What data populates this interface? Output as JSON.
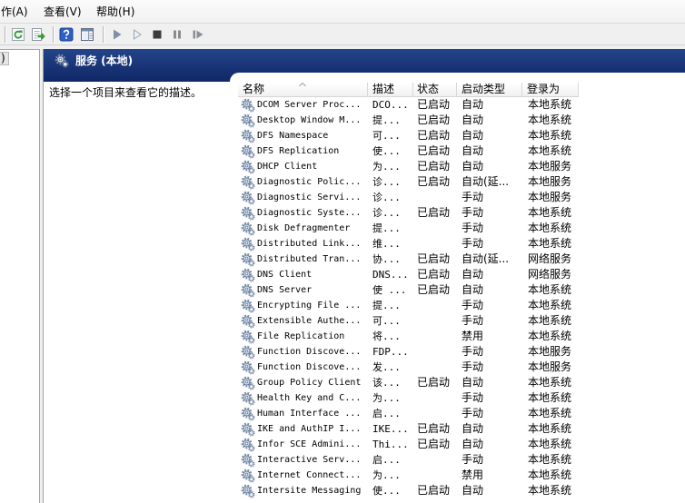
{
  "menu": {
    "items": [
      {
        "label": "作(A)"
      },
      {
        "label": "查看(V)"
      },
      {
        "label": "帮助(H)"
      }
    ]
  },
  "toolbar": {
    "buttons": [
      {
        "icon": "refresh-icon"
      },
      {
        "icon": "export-list-icon"
      },
      {
        "icon": "help-icon"
      },
      {
        "icon": "show-hide-pane-icon"
      },
      {
        "icon": "start-service-icon"
      },
      {
        "icon": "start-service-outline-icon"
      },
      {
        "icon": "stop-service-icon"
      },
      {
        "icon": "pause-service-icon"
      },
      {
        "icon": "restart-service-icon"
      }
    ]
  },
  "tree": {
    "selected_item_label": ")"
  },
  "panel": {
    "title": "服务 (本地)",
    "title_icon": "services-gear-icon",
    "description_hint": "选择一个项目来查看它的描述。"
  },
  "list": {
    "columns": [
      "名称",
      "描述",
      "状态",
      "启动类型",
      "登录为"
    ],
    "sort_icon": "sort-ascending-icon",
    "row_icon": "service-gear-icon",
    "rows": [
      {
        "name": "DCOM Server Proc...",
        "description": "DCO...",
        "status": "已启动",
        "startup_type": "自动",
        "log_on_as": "本地系统"
      },
      {
        "name": "Desktop Window M...",
        "description": "提...",
        "status": "已启动",
        "startup_type": "自动",
        "log_on_as": "本地系统"
      },
      {
        "name": "DFS Namespace",
        "description": "可...",
        "status": "已启动",
        "startup_type": "自动",
        "log_on_as": "本地系统"
      },
      {
        "name": "DFS Replication",
        "description": "使...",
        "status": "已启动",
        "startup_type": "自动",
        "log_on_as": "本地系统"
      },
      {
        "name": "DHCP Client",
        "description": "为...",
        "status": "已启动",
        "startup_type": "自动",
        "log_on_as": "本地服务"
      },
      {
        "name": "Diagnostic Polic...",
        "description": "诊...",
        "status": "已启动",
        "startup_type": "自动(延...",
        "log_on_as": "本地服务"
      },
      {
        "name": "Diagnostic Servi...",
        "description": "诊...",
        "status": "",
        "startup_type": "手动",
        "log_on_as": "本地服务"
      },
      {
        "name": "Diagnostic Syste...",
        "description": "诊...",
        "status": "已启动",
        "startup_type": "手动",
        "log_on_as": "本地系统"
      },
      {
        "name": "Disk Defragmenter",
        "description": "提...",
        "status": "",
        "startup_type": "手动",
        "log_on_as": "本地系统"
      },
      {
        "name": "Distributed Link...",
        "description": "维...",
        "status": "",
        "startup_type": "手动",
        "log_on_as": "本地系统"
      },
      {
        "name": "Distributed Tran...",
        "description": "协...",
        "status": "已启动",
        "startup_type": "自动(延...",
        "log_on_as": "网络服务"
      },
      {
        "name": "DNS Client",
        "description": "DNS...",
        "status": "已启动",
        "startup_type": "自动",
        "log_on_as": "网络服务"
      },
      {
        "name": "DNS Server",
        "description": "使 ...",
        "status": "已启动",
        "startup_type": "自动",
        "log_on_as": "本地系统"
      },
      {
        "name": "Encrypting File ...",
        "description": "提...",
        "status": "",
        "startup_type": "手动",
        "log_on_as": "本地系统"
      },
      {
        "name": "Extensible Authe...",
        "description": "可...",
        "status": "",
        "startup_type": "手动",
        "log_on_as": "本地系统"
      },
      {
        "name": "File Replication",
        "description": "将...",
        "status": "",
        "startup_type": "禁用",
        "log_on_as": "本地系统"
      },
      {
        "name": "Function Discove...",
        "description": "FDP...",
        "status": "",
        "startup_type": "手动",
        "log_on_as": "本地服务"
      },
      {
        "name": "Function Discove...",
        "description": "发...",
        "status": "",
        "startup_type": "手动",
        "log_on_as": "本地服务"
      },
      {
        "name": "Group Policy Client",
        "description": "该...",
        "status": "已启动",
        "startup_type": "自动",
        "log_on_as": "本地系统"
      },
      {
        "name": "Health Key and C...",
        "description": "为...",
        "status": "",
        "startup_type": "手动",
        "log_on_as": "本地系统"
      },
      {
        "name": "Human Interface ...",
        "description": "启...",
        "status": "",
        "startup_type": "手动",
        "log_on_as": "本地系统"
      },
      {
        "name": "IKE and AuthIP I...",
        "description": "IKE...",
        "status": "已启动",
        "startup_type": "自动",
        "log_on_as": "本地系统"
      },
      {
        "name": "Infor SCE Admini...",
        "description": "Thi...",
        "status": "已启动",
        "startup_type": "自动",
        "log_on_as": "本地系统"
      },
      {
        "name": "Interactive Serv...",
        "description": "启...",
        "status": "",
        "startup_type": "手动",
        "log_on_as": "本地系统"
      },
      {
        "name": "Internet Connect...",
        "description": "为...",
        "status": "",
        "startup_type": "禁用",
        "log_on_as": "本地系统"
      },
      {
        "name": "Intersite Messaging",
        "description": "使...",
        "status": "已启动",
        "startup_type": "自动",
        "log_on_as": "本地系统"
      }
    ]
  },
  "colors": {
    "window_bg": "#f0f0f0",
    "header_band_top": "#24448a",
    "header_band_bottom": "#0f2766"
  }
}
